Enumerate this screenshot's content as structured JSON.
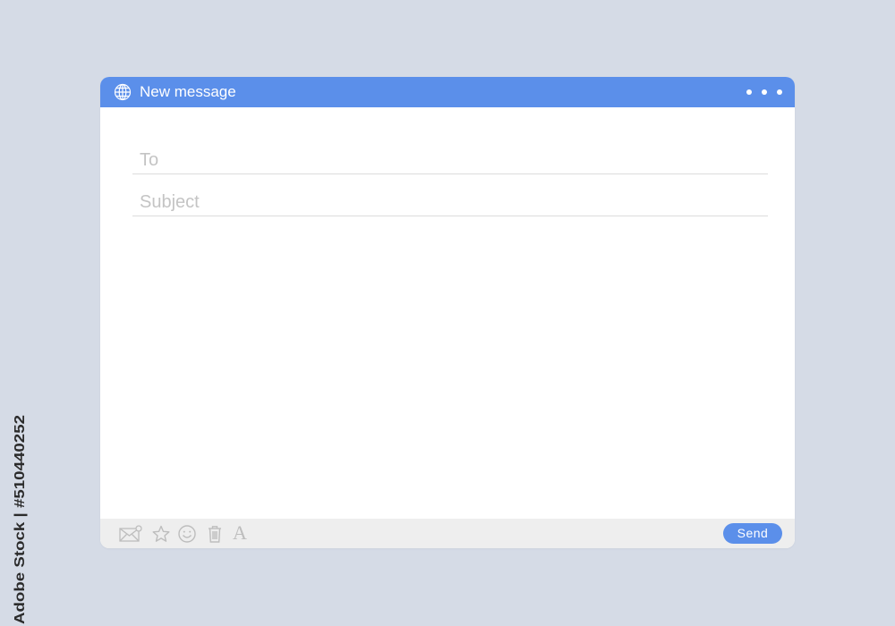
{
  "window": {
    "title": "New message"
  },
  "compose": {
    "to_placeholder": "To",
    "to_value": "",
    "subject_placeholder": "Subject",
    "subject_value": "",
    "body_value": ""
  },
  "toolbar": {
    "icons": [
      "envelope-icon",
      "star-icon",
      "smiley-icon",
      "trash-icon",
      "font-icon"
    ],
    "font_label": "A",
    "send_label": "Send"
  },
  "watermark": {
    "side_text": "Adobe Stock | #510440252"
  },
  "colors": {
    "accent": "#5b8fea",
    "background": "#d5dbe6",
    "footer": "#eeeeee",
    "icon_gray": "#bdbdbd"
  }
}
